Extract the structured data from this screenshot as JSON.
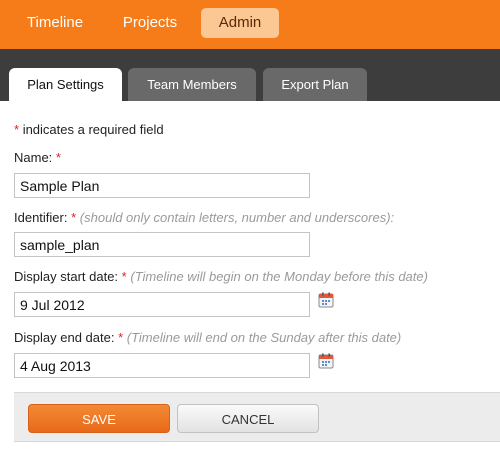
{
  "nav": {
    "items": [
      {
        "label": "Timeline"
      },
      {
        "label": "Projects"
      },
      {
        "label": "Admin"
      }
    ],
    "active": "Admin"
  },
  "tabs": [
    {
      "label": "Plan Settings"
    },
    {
      "label": "Team Members"
    },
    {
      "label": "Export Plan"
    }
  ],
  "form": {
    "required_star": "*",
    "required_note": "indicates a required field",
    "name": {
      "label": "Name:",
      "value": "Sample Plan"
    },
    "identifier": {
      "label": "Identifier:",
      "hint": "(should only contain letters, number and underscores):",
      "value": "sample_plan"
    },
    "start_date": {
      "label": "Display start date:",
      "hint": "(Timeline will begin on the Monday before this date)",
      "value": "9 Jul 2012"
    },
    "end_date": {
      "label": "Display end date:",
      "hint": "(Timeline will end on the Sunday after this date)",
      "value": "4 Aug 2013"
    }
  },
  "actions": {
    "save_label": "SAVE",
    "cancel_label": "CANCEL"
  },
  "icons": {
    "calendar": "calendar-icon"
  },
  "colors": {
    "brand_orange": "#f57c18",
    "tab_bar": "#3d3d3d",
    "required": "#d4262a"
  }
}
